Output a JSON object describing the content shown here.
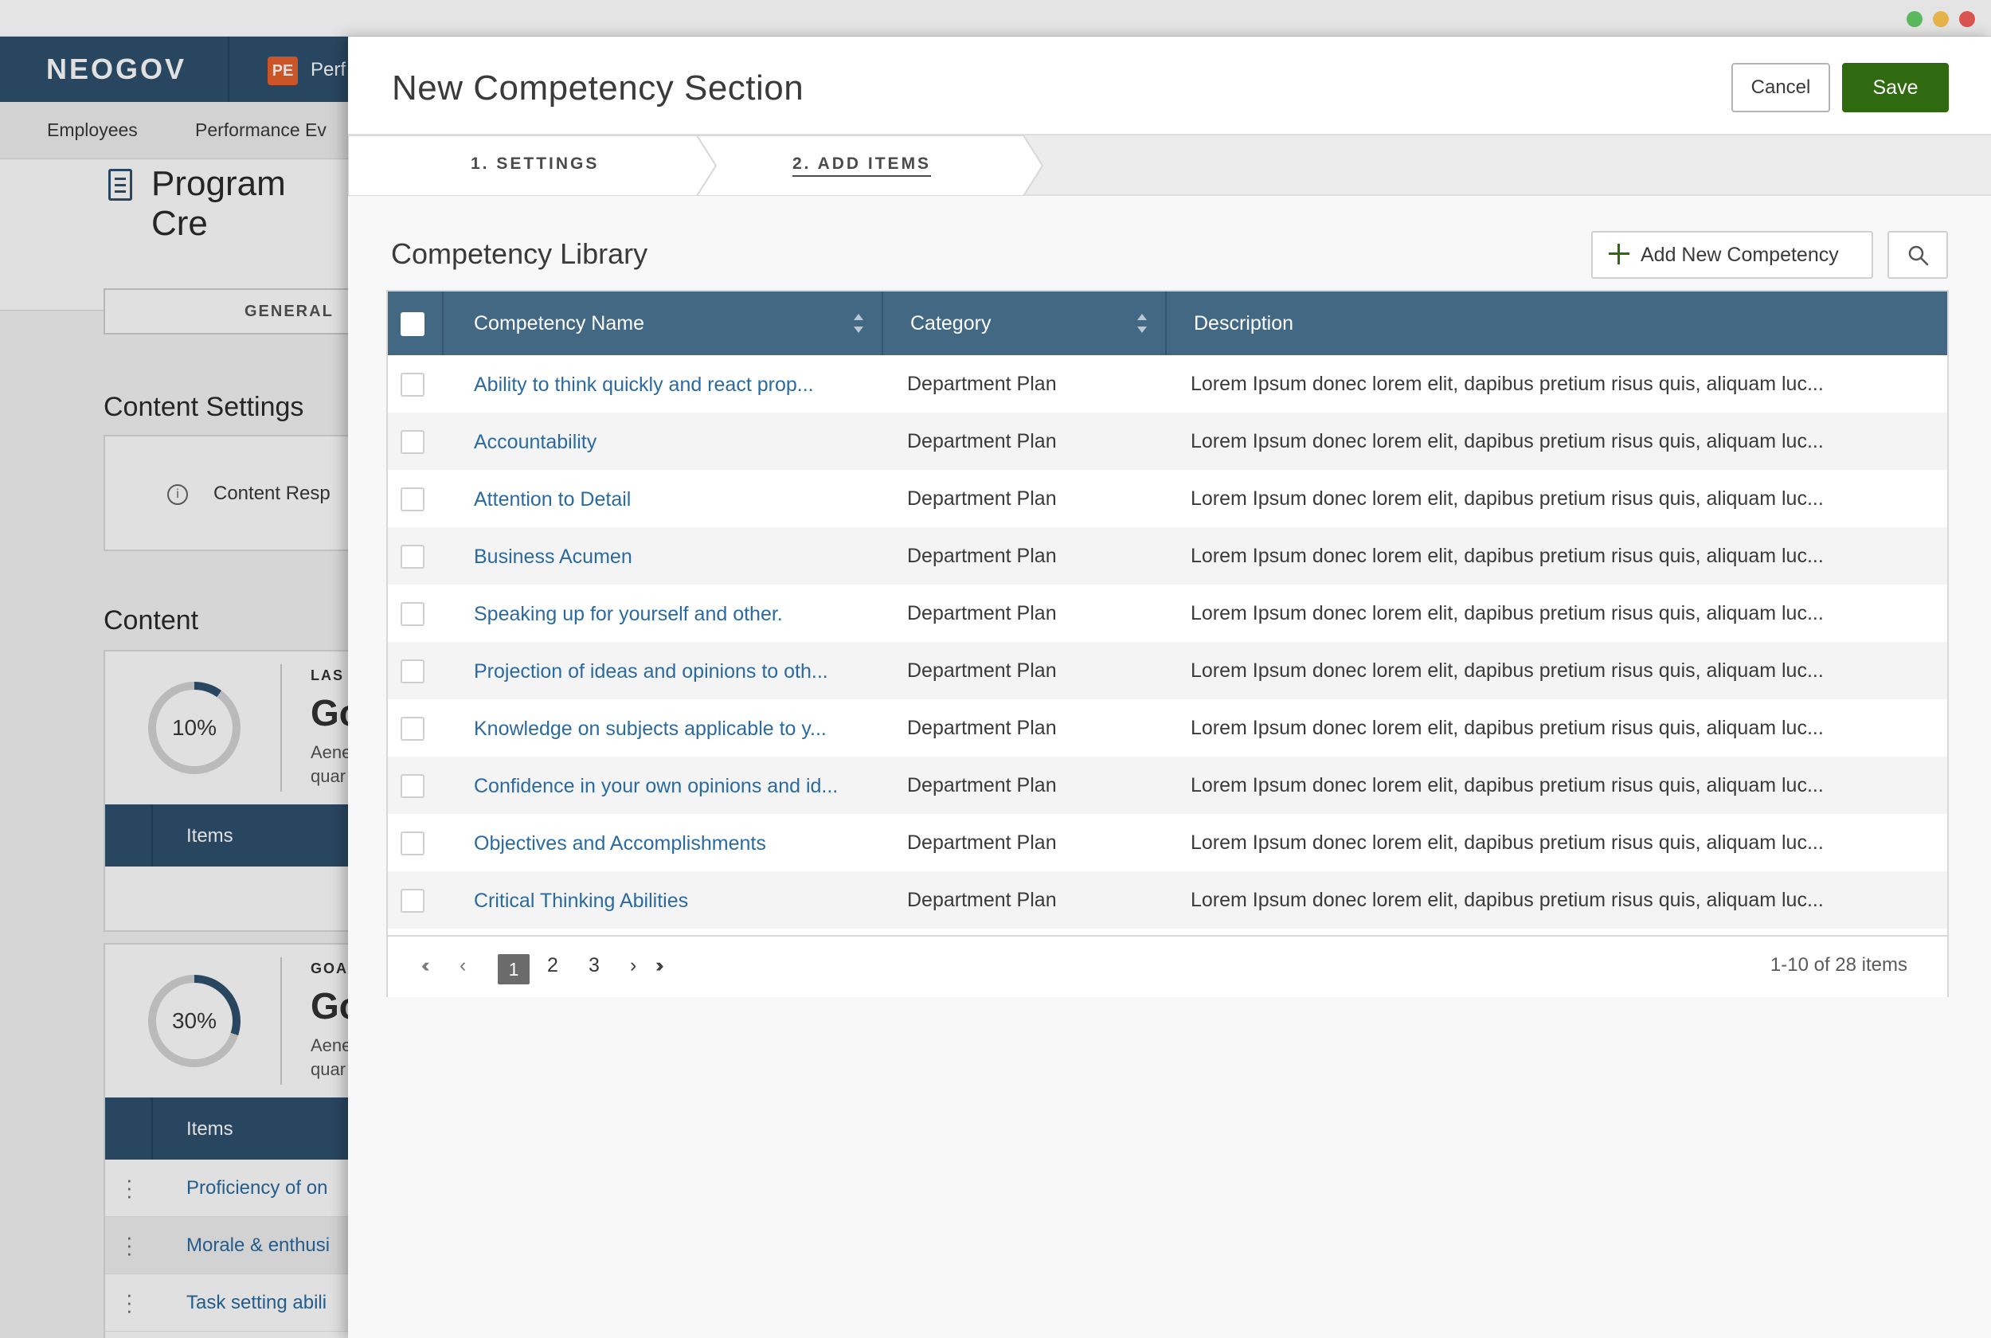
{
  "background": {
    "logo": "NEOGOV",
    "product_badge": "PE",
    "product_name": "Perf",
    "nav": [
      "Employees",
      "Performance Ev"
    ],
    "page_title": "Program Cre",
    "tab_label": "GENERAL",
    "content_settings": {
      "heading": "Content Settings",
      "info_text": "Content Resp"
    },
    "content": {
      "heading": "Content",
      "cards": [
        {
          "percent": "10%",
          "percent_value": 10,
          "label": "LAS",
          "title": "Go",
          "desc_line1": "Aene",
          "desc_line2": "quar",
          "items_label": "Items"
        },
        {
          "percent": "30%",
          "percent_value": 30,
          "label": "GOA",
          "title": "Go",
          "desc_line1": "Aene",
          "desc_line2": "quar",
          "items_label": "Items"
        }
      ],
      "list_items": [
        "Proficiency of on",
        "Morale & enthusi",
        "Task setting abili"
      ]
    }
  },
  "panel": {
    "title": "New Competency Section",
    "cancel_label": "Cancel",
    "save_label": "Save",
    "steps": [
      "1. SETTINGS",
      "2. ADD ITEMS"
    ],
    "library_title": "Competency Library",
    "add_button_label": "Add New Competency",
    "table": {
      "columns": [
        "Competency Name",
        "Category",
        "Description"
      ],
      "rows": [
        {
          "name": "Ability to think quickly and react prop...",
          "category": "Department Plan",
          "description": "Lorem Ipsum donec lorem elit, dapibus pretium risus quis, aliquam luc..."
        },
        {
          "name": "Accountability",
          "category": "Department Plan",
          "description": "Lorem Ipsum donec lorem elit, dapibus pretium risus quis, aliquam luc..."
        },
        {
          "name": "Attention to Detail",
          "category": "Department Plan",
          "description": "Lorem Ipsum donec lorem elit, dapibus pretium risus quis, aliquam luc..."
        },
        {
          "name": "Business Acumen",
          "category": "Department Plan",
          "description": "Lorem Ipsum donec lorem elit, dapibus pretium risus quis, aliquam luc..."
        },
        {
          "name": "Speaking up for yourself and other.",
          "category": "Department Plan",
          "description": "Lorem Ipsum donec lorem elit, dapibus pretium risus quis, aliquam luc..."
        },
        {
          "name": "Projection of ideas and opinions to oth...",
          "category": "Department Plan",
          "description": "Lorem Ipsum donec lorem elit, dapibus pretium risus quis, aliquam luc..."
        },
        {
          "name": "Knowledge on subjects applicable to y...",
          "category": "Department Plan",
          "description": "Lorem Ipsum donec lorem elit, dapibus pretium risus quis, aliquam luc..."
        },
        {
          "name": "Confidence in your own opinions and id...",
          "category": "Department Plan",
          "description": "Lorem Ipsum donec lorem elit, dapibus pretium risus quis, aliquam luc..."
        },
        {
          "name": "Objectives and Accomplishments",
          "category": "Department Plan",
          "description": "Lorem Ipsum donec lorem elit, dapibus pretium risus quis, aliquam luc..."
        },
        {
          "name": "Critical Thinking Abilities",
          "category": "Department Plan",
          "description": "Lorem Ipsum donec lorem elit, dapibus pretium risus quis, aliquam luc..."
        }
      ]
    },
    "pagination": {
      "pages": [
        "1",
        "2",
        "3"
      ],
      "current": "1",
      "summary": "1-10 of 28 items"
    }
  },
  "colors": {
    "brand_navy": "#2f506e",
    "table_header": "#436884",
    "save_green": "#2f6a10",
    "link_blue": "#2b6aa0",
    "badge_orange": "#e8612c"
  },
  "icons": [
    "close-icon",
    "minimize-icon",
    "maximize-icon",
    "document-icon",
    "info-icon",
    "plus-icon",
    "search-icon",
    "sort-icon",
    "first-page-icon",
    "prev-page-icon",
    "next-page-icon",
    "last-page-icon",
    "drag-handle-icon"
  ]
}
